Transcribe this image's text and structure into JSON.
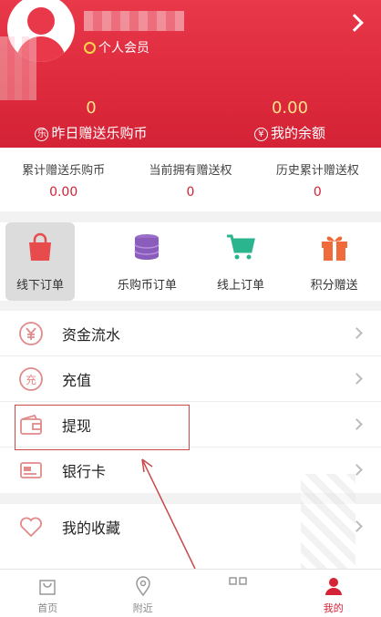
{
  "profile": {
    "member_label": "个人会员"
  },
  "stats": {
    "yesterday_value": "0",
    "yesterday_label": "昨日赠送乐购币",
    "yesterday_icon_char": "乐",
    "balance_value": "0.00",
    "balance_label": "我的余额",
    "balance_icon_char": "¥"
  },
  "counts": [
    {
      "label": "累计赠送乐购币",
      "value": "0.00"
    },
    {
      "label": "当前拥有赠送权",
      "value": "0"
    },
    {
      "label": "历史累计赠送权",
      "value": "0"
    }
  ],
  "orders": [
    {
      "label": "线下订单",
      "icon": "shopping-bag-icon"
    },
    {
      "label": "乐购币订单",
      "icon": "coin-stack-icon"
    },
    {
      "label": "线上订单",
      "icon": "shopping-cart-icon"
    },
    {
      "label": "积分赠送",
      "icon": "gift-icon"
    }
  ],
  "menu1": [
    {
      "label": "资金流水",
      "icon": "yen-circle-icon"
    },
    {
      "label": "充值",
      "icon": "recharge-icon",
      "icon_char": "充"
    },
    {
      "label": "提现",
      "icon": "wallet-icon"
    },
    {
      "label": "银行卡",
      "icon": "bank-card-icon"
    }
  ],
  "menu2": [
    {
      "label": "我的收藏",
      "icon": "heart-icon"
    }
  ],
  "tabs": [
    {
      "label": "首页",
      "icon": "home-bag-icon"
    },
    {
      "label": "附近",
      "icon": "location-pin-icon"
    },
    {
      "label": "",
      "icon": "grid-icon"
    },
    {
      "label": "我的",
      "icon": "user-icon",
      "active": true
    }
  ],
  "colors": {
    "brand": "#d42236",
    "accent_yellow": "#ffe38a"
  }
}
